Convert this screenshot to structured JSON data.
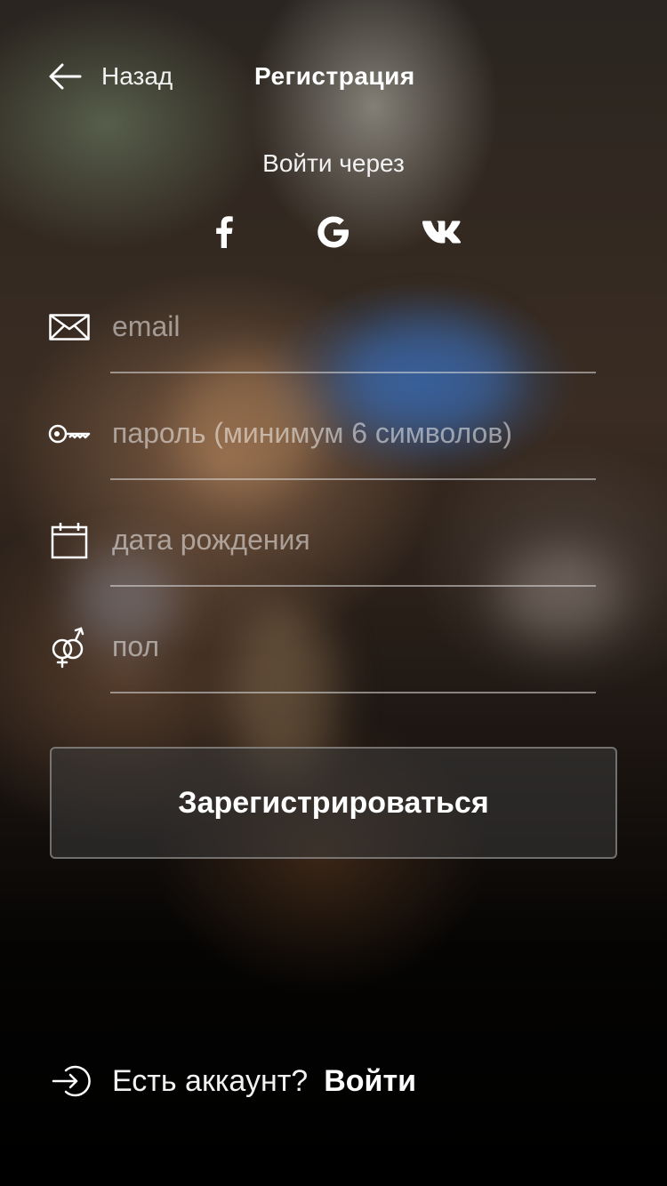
{
  "header": {
    "back_label": "Назад",
    "title": "Регистрация"
  },
  "social": {
    "title": "Войти через",
    "providers": [
      {
        "name": "facebook",
        "icon": "facebook-icon"
      },
      {
        "name": "google",
        "icon": "google-icon"
      },
      {
        "name": "vk",
        "icon": "vk-icon"
      }
    ]
  },
  "form": {
    "email_placeholder": "email",
    "email_value": "",
    "password_placeholder": "пароль (минимум 6 символов)",
    "password_value": "",
    "birthdate_placeholder": "дата рождения",
    "birthdate_value": "",
    "gender_placeholder": "пол",
    "gender_value": "",
    "submit_label": "Зарегистрироваться"
  },
  "footer": {
    "question": "Есть аккаунт?",
    "login_label": "Войти"
  },
  "colors": {
    "text": "#ffffff",
    "placeholder": "#8a8a8a",
    "button_bg": "#3c3c3c",
    "background_bottom": "#000000"
  },
  "icons": {
    "back": "arrow-left-icon",
    "email": "envelope-icon",
    "password": "key-icon",
    "birthdate": "calendar-icon",
    "gender": "gender-icon",
    "login": "sign-in-icon"
  }
}
